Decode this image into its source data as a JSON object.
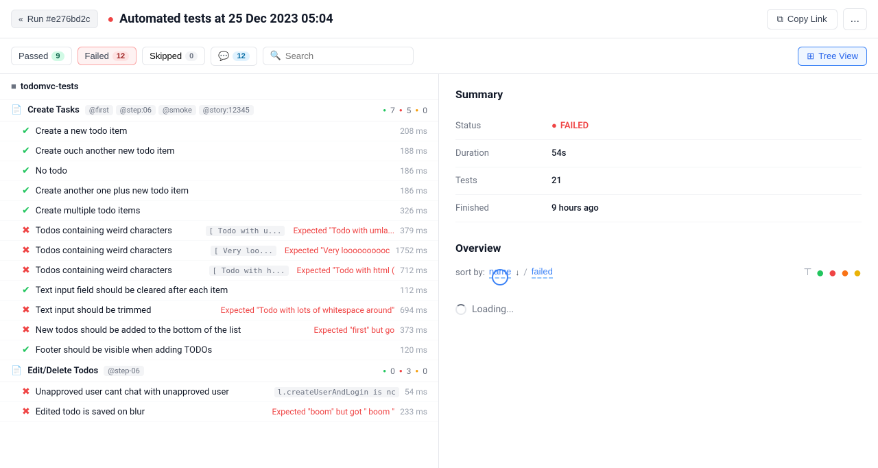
{
  "header": {
    "back_label": "Run #e276bd2c",
    "title": "Automated tests at 25 Dec 2023 05:04",
    "copy_link_label": "Copy Link",
    "more_label": "..."
  },
  "toolbar": {
    "passed_label": "Passed",
    "passed_count": "9",
    "failed_label": "Failed",
    "failed_count": "12",
    "skipped_label": "Skipped",
    "skipped_count": "0",
    "comment_count": "12",
    "search_placeholder": "Search",
    "tree_view_label": "Tree View"
  },
  "left_panel": {
    "folder_name": "todomvc-tests",
    "suites": [
      {
        "name": "Create Tasks",
        "tags": [
          "@first",
          "@step:06",
          "@smoke",
          "@story:12345"
        ],
        "counts": {
          "green": 7,
          "red": 5,
          "gray": 0
        },
        "tests": [
          {
            "status": "pass",
            "name": "Create a new todo item",
            "error": "",
            "time": "208 ms"
          },
          {
            "status": "pass",
            "name": "Create ouch another new todo item",
            "error": "",
            "time": "188 ms"
          },
          {
            "status": "pass",
            "name": "No todo",
            "error": "",
            "time": "186 ms"
          },
          {
            "status": "pass",
            "name": "Create another one plus new todo item",
            "error": "",
            "time": "186 ms"
          },
          {
            "status": "pass",
            "name": "Create multiple todo items",
            "error": "",
            "time": "326 ms"
          },
          {
            "status": "fail",
            "name": "Todos containing weird characters",
            "error_code": "[ Todo with u...",
            "error_msg": "Expected \"Todo with umla...",
            "time": "379 ms"
          },
          {
            "status": "fail",
            "name": "Todos containing weird characters",
            "error_code": "[ Very loo...",
            "error_msg": "Expected \"Very loooooooooc",
            "time": "1752 ms"
          },
          {
            "status": "fail",
            "name": "Todos containing weird characters",
            "error_code": "[ Todo with h...",
            "error_msg": "Expected \"Todo with html (",
            "time": "712 ms"
          },
          {
            "status": "pass",
            "name": "Text input field should be cleared after each item",
            "error": "",
            "time": "112 ms"
          },
          {
            "status": "fail",
            "name": "Text input should be trimmed",
            "error_msg": "Expected \"Todo with lots of whitespace around\"",
            "time": "694 ms"
          },
          {
            "status": "fail",
            "name": "New todos should be added to the bottom of the list",
            "error_msg": "Expected \"first\" but go",
            "time": "373 ms"
          },
          {
            "status": "pass",
            "name": "Footer should be visible when adding TODOs",
            "error": "",
            "time": "120 ms"
          }
        ]
      },
      {
        "name": "Edit/Delete Todos",
        "tags": [
          "@step-06"
        ],
        "counts": {
          "green": 0,
          "red": 3,
          "gray": 0
        },
        "tests": [
          {
            "status": "fail",
            "name": "Unapproved user cant chat with unapproved user",
            "error_code": "l.createUserAndLogin is nc",
            "time": "54 ms"
          },
          {
            "status": "fail",
            "name": "Edited todo is saved on blur",
            "error_msg": "Expected \"boom\" but got \" boom \"",
            "time": "233 ms"
          }
        ]
      }
    ]
  },
  "right_panel": {
    "summary_title": "Summary",
    "summary": {
      "status_label": "Status",
      "status_value": "FAILED",
      "duration_label": "Duration",
      "duration_value": "54s",
      "tests_label": "Tests",
      "tests_value": "21",
      "finished_label": "Finished",
      "finished_value": "9 hours ago"
    },
    "overview_title": "Overview",
    "sort_label": "sort by:",
    "sort_name": "name",
    "sort_failed": "failed",
    "loading_label": "Loading..."
  }
}
